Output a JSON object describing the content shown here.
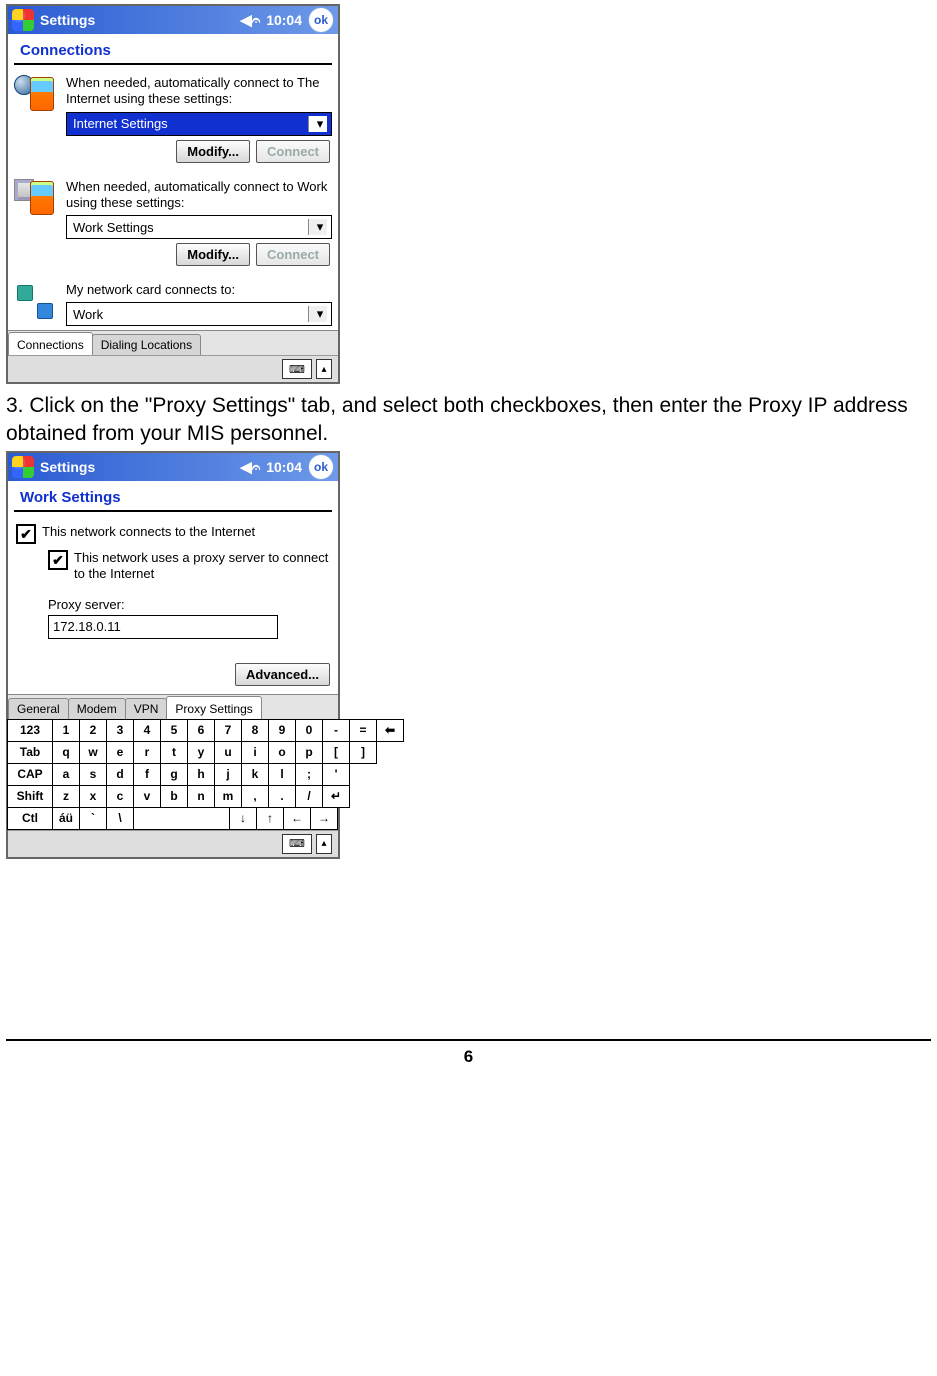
{
  "screen1": {
    "titlebar": {
      "title": "Settings",
      "time": "10:04",
      "ok": "ok"
    },
    "subtitle": "Connections",
    "internet": {
      "label": "When needed, automatically connect to The Internet using these settings:",
      "value": "Internet Settings",
      "modify": "Modify...",
      "connect": "Connect"
    },
    "work": {
      "label": "When needed, automatically connect to Work using these settings:",
      "value": "Work Settings",
      "modify": "Modify...",
      "connect": "Connect"
    },
    "nic": {
      "label": "My network card connects to:",
      "value": "Work"
    },
    "tabs": [
      "Connections",
      "Dialing Locations"
    ]
  },
  "caption": "3. Click on the \"Proxy Settings\" tab, and select both checkboxes, then enter the Proxy IP address obtained from your MIS personnel.",
  "screen2": {
    "titlebar": {
      "title": "Settings",
      "time": "10:04",
      "ok": "ok"
    },
    "subtitle": "Work Settings",
    "chk1": "This network connects to the Internet",
    "chk2": "This network uses a proxy server to connect to the Internet",
    "proxy_label": "Proxy server:",
    "proxy_value": "172.18.0.11",
    "advanced": "Advanced...",
    "tabs": [
      "General",
      "Modem",
      "VPN",
      "Proxy Settings"
    ],
    "keyboard": {
      "r1": [
        "123",
        "1",
        "2",
        "3",
        "4",
        "5",
        "6",
        "7",
        "8",
        "9",
        "0",
        "-",
        "=",
        "⬅"
      ],
      "r2": [
        "Tab",
        "q",
        "w",
        "e",
        "r",
        "t",
        "y",
        "u",
        "i",
        "o",
        "p",
        "[",
        "]"
      ],
      "r3": [
        "CAP",
        "a",
        "s",
        "d",
        "f",
        "g",
        "h",
        "j",
        "k",
        "l",
        ";",
        "'"
      ],
      "r4": [
        "Shift",
        "z",
        "x",
        "c",
        "v",
        "b",
        "n",
        "m",
        ",",
        ".",
        "/",
        "↵"
      ],
      "r5": [
        "Ctl",
        "áü",
        "`",
        "\\",
        " ",
        "↓",
        "↑",
        "←",
        "→"
      ]
    }
  },
  "page_number": "6"
}
